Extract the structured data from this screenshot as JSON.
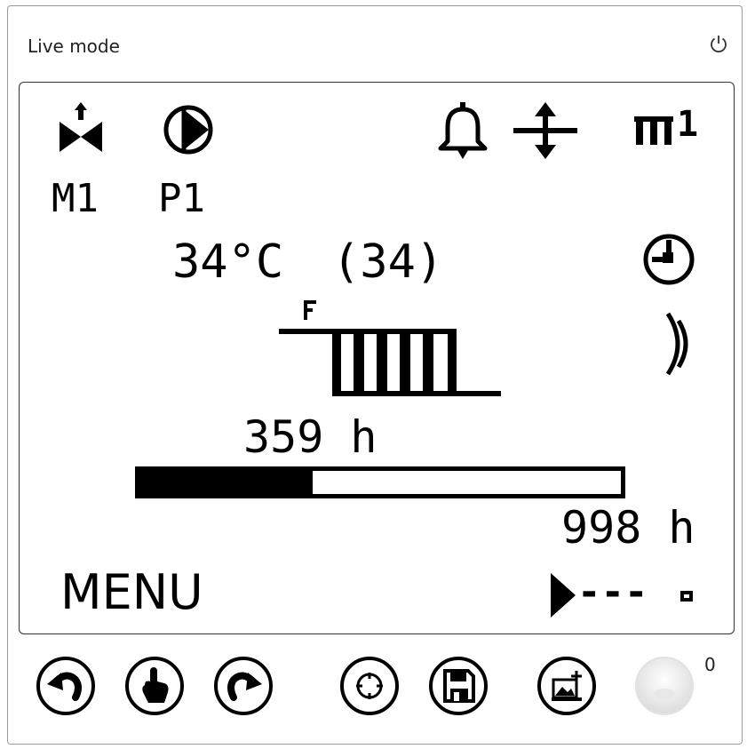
{
  "window": {
    "title": "Live mode"
  },
  "lcd": {
    "mixer_label": "M1",
    "pump_label": "P1",
    "circuit_label": "1",
    "temperature": "34°C",
    "setpoint": "(34)",
    "hours_elapsed": "359 h",
    "hours_total": "998 h",
    "progress_fraction": 0.36,
    "menu_label": "MENU",
    "nav_indicator": "---"
  },
  "toolbar": {
    "counter": "0",
    "buttons": [
      "undo",
      "touch",
      "redo",
      "target",
      "save",
      "add-screenshot",
      "record"
    ]
  },
  "icons": [
    "mixer-valve-icon",
    "pump-icon",
    "bell-icon",
    "up-down-arrow-icon",
    "heating-circuit-icon",
    "clock-icon",
    "moon-icon",
    "radiator-icon",
    "play-icon",
    "power-icon"
  ]
}
